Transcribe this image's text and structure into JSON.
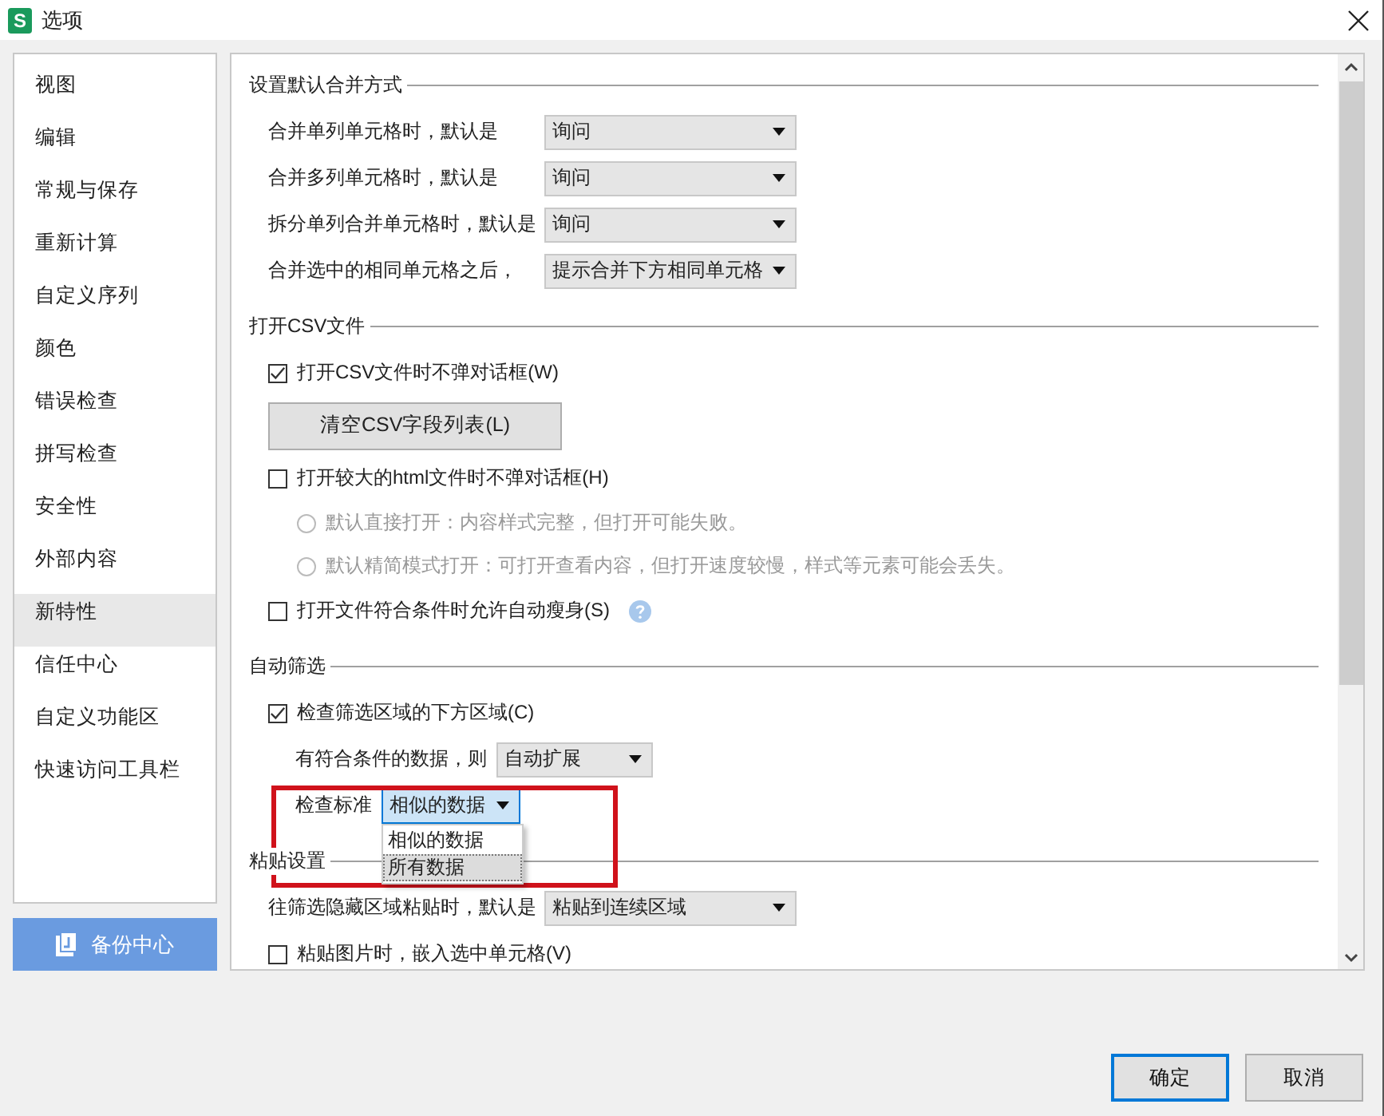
{
  "window": {
    "title": "选项",
    "app_icon": "S"
  },
  "sidebar": {
    "items": [
      {
        "label": "视图",
        "selected": false
      },
      {
        "label": "编辑",
        "selected": false
      },
      {
        "label": "常规与保存",
        "selected": false
      },
      {
        "label": "重新计算",
        "selected": false
      },
      {
        "label": "自定义序列",
        "selected": false
      },
      {
        "label": "颜色",
        "selected": false
      },
      {
        "label": "错误检查",
        "selected": false
      },
      {
        "label": "拼写检查",
        "selected": false
      },
      {
        "label": "安全性",
        "selected": false
      },
      {
        "label": "外部内容",
        "selected": false
      },
      {
        "label": "新特性",
        "selected": true
      },
      {
        "label": "信任中心",
        "selected": false
      },
      {
        "label": "自定义功能区",
        "selected": false
      },
      {
        "label": "快速访问工具栏",
        "selected": false
      }
    ]
  },
  "backup_button": "备份中心",
  "sections": [
    {
      "title": "设置默认合并方式",
      "rows": [
        {
          "kind": "select",
          "label": "合并单列单元格时，默认是",
          "value": "询问"
        },
        {
          "kind": "select",
          "label": "合并多列单元格时，默认是",
          "value": "询问"
        },
        {
          "kind": "select",
          "label": "拆分单列合并单元格时，默认是",
          "value": "询问"
        },
        {
          "kind": "select",
          "label": "合并选中的相同单元格之后，",
          "value": "提示合并下方相同单元格"
        }
      ]
    },
    {
      "title": "打开CSV文件",
      "rows": [
        {
          "kind": "checkbox",
          "label": "打开CSV文件时不弹对话框(W)",
          "checked": true
        },
        {
          "kind": "button",
          "label": "清空CSV字段列表(L)"
        },
        {
          "kind": "checkbox",
          "label": "打开较大的html文件时不弹对话框(H)",
          "checked": false
        },
        {
          "kind": "radio",
          "label": "默认直接打开：内容样式完整，但打开可能失败。",
          "selected": false,
          "disabled": true
        },
        {
          "kind": "radio",
          "label": "默认精简模式打开：可打开查看内容，但打开速度较慢，样式等元素可能会丢失。",
          "selected": false,
          "disabled": true
        },
        {
          "kind": "checkbox",
          "label": "打开文件符合条件时允许自动瘦身(S)",
          "checked": false,
          "help": true
        }
      ]
    },
    {
      "title": "自动筛选",
      "rows": [
        {
          "kind": "checkbox",
          "label": "检查筛选区域的下方区域(C)",
          "checked": true
        },
        {
          "kind": "subselect",
          "label": "有符合条件的数据，则",
          "value": "自动扩展"
        },
        {
          "kind": "openselect",
          "label": "检查标准",
          "value": "相似的数据",
          "options": [
            {
              "label": "相似的数据",
              "highlighted": false
            },
            {
              "label": "所有数据",
              "highlighted": true
            }
          ]
        }
      ]
    },
    {
      "title": "粘贴设置",
      "rows": [
        {
          "kind": "select",
          "label": "往筛选隐藏区域粘贴时，默认是",
          "value": "粘贴到连续区域"
        },
        {
          "kind": "checkbox",
          "label": "粘贴图片时，嵌入选中单元格(V)",
          "checked": false
        }
      ]
    }
  ],
  "buttons": [
    {
      "label": "确定",
      "default": true
    },
    {
      "label": "取消",
      "default": false
    }
  ]
}
